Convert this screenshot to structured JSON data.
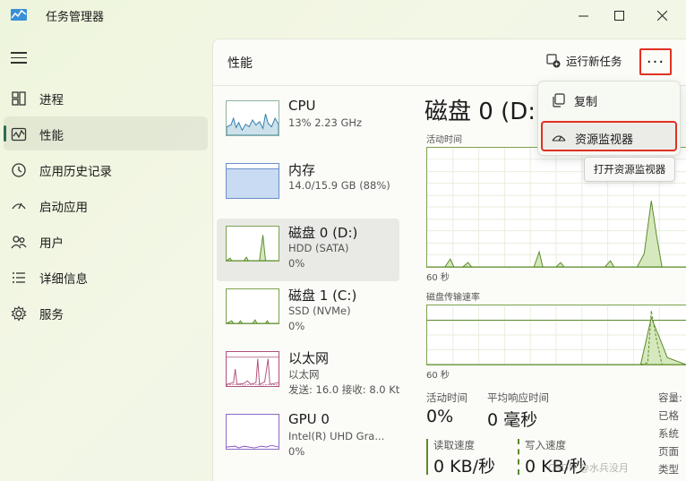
{
  "window": {
    "title": "任务管理器",
    "icon": "task-manager-icon"
  },
  "nav": {
    "items": [
      {
        "label": "进程",
        "icon": "processes-icon"
      },
      {
        "label": "性能",
        "icon": "performance-icon",
        "active": true
      },
      {
        "label": "应用历史记录",
        "icon": "history-icon"
      },
      {
        "label": "启动应用",
        "icon": "startup-icon"
      },
      {
        "label": "用户",
        "icon": "users-icon"
      },
      {
        "label": "详细信息",
        "icon": "details-icon"
      },
      {
        "label": "服务",
        "icon": "services-icon"
      }
    ]
  },
  "header": {
    "title": "性能",
    "run_task": "运行新任务",
    "more": "···"
  },
  "perf_list": [
    {
      "name": "CPU",
      "sub1": "13% 2.23 GHz",
      "sub2": ""
    },
    {
      "name": "内存",
      "sub1": "14.0/15.9 GB (88%)",
      "sub2": ""
    },
    {
      "name": "磁盘 0 (D:)",
      "sub1": "HDD (SATA)",
      "sub2": "0%"
    },
    {
      "name": "磁盘 1 (C:)",
      "sub1": "SSD (NVMe)",
      "sub2": "0%"
    },
    {
      "name": "以太网",
      "sub1": "以太网",
      "sub2": "发送: 16.0 接收: 8.0 Kt"
    },
    {
      "name": "GPU 0",
      "sub1": "Intel(R) UHD Gra...",
      "sub2": "0%"
    }
  ],
  "detail": {
    "title": "磁盘 0 (D:)",
    "graph1_label": "活动时间",
    "graph1_time": "60 秒",
    "graph2_label": "磁盘传输速率",
    "graph2_time": "60 秒",
    "active_time_label": "活动时间",
    "active_time_value": "0%",
    "avg_response_label": "平均响应时间",
    "avg_response_value": "0 毫秒",
    "read_label": "读取速度",
    "read_value": "0 KB/秒",
    "write_label": "写入速度",
    "write_value": "0 KB/秒",
    "side_labels": [
      "容量:",
      "已格",
      "系统",
      "页面",
      "类型"
    ]
  },
  "popup": {
    "copy": "复制",
    "resource_monitor": "资源监视器",
    "tooltip": "打开资源监视器"
  },
  "watermark": "CSDN @水兵没月",
  "colors": {
    "accent": "#2d6b55",
    "highlight_border": "#e03022",
    "disk_graph": "#7ba24e"
  }
}
